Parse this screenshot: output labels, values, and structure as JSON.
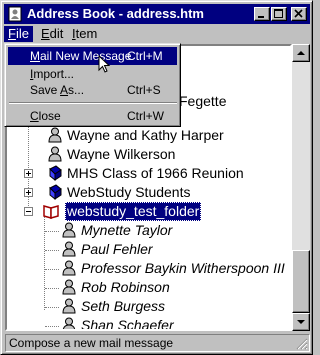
{
  "window": {
    "title": "Address Book - address.htm"
  },
  "menubar": {
    "file": {
      "pre": "",
      "acc": "F",
      "post": "ile"
    },
    "edit": {
      "pre": "",
      "acc": "E",
      "post": "dit"
    },
    "item": {
      "pre": "",
      "acc": "I",
      "post": "tem"
    }
  },
  "file_menu": {
    "items": [
      {
        "pre": "",
        "acc": "M",
        "post": "ail New Message",
        "shortcut": "Ctrl+M",
        "highlighted": true
      },
      {
        "pre": "",
        "acc": "I",
        "post": "mport...",
        "shortcut": ""
      },
      {
        "pre": "Save ",
        "acc": "A",
        "post": "s...",
        "shortcut": "Ctrl+S"
      },
      {
        "pre": "",
        "acc": "C",
        "post": "lose",
        "shortcut": "Ctrl+W"
      }
    ]
  },
  "tree": {
    "partial_row": "Fegette",
    "entries": [
      {
        "label": "Wayne and Kathy Harper"
      },
      {
        "label": "Wayne Wilkerson"
      }
    ],
    "folders": [
      {
        "label": "MHS Class of 1966 Reunion"
      },
      {
        "label": "WebStudy Students"
      },
      {
        "label": "webstudy_test_folder"
      }
    ],
    "children": [
      {
        "label": "Mynette Taylor"
      },
      {
        "label": "Paul Fehler"
      },
      {
        "label": "Professor Baykin Witherspoon III"
      },
      {
        "label": "Rob Robinson"
      },
      {
        "label": "Seth Burgess"
      },
      {
        "label": "Shan Schaefer"
      }
    ]
  },
  "scrollbar": {
    "position": 0.85
  },
  "status": {
    "text": "Compose a new mail message"
  },
  "colors": {
    "title_bar": "#000080",
    "selection": "#000080",
    "face": "#c0c0c0",
    "book_icon": "#0000a8"
  },
  "icons": [
    "address-book-icon",
    "minimize-icon",
    "maximize-icon",
    "close-icon",
    "person-icon",
    "book-icon",
    "open-book-icon",
    "arrow-up-icon",
    "arrow-down-icon",
    "mouse-cursor-icon",
    "size-grip-icon"
  ]
}
